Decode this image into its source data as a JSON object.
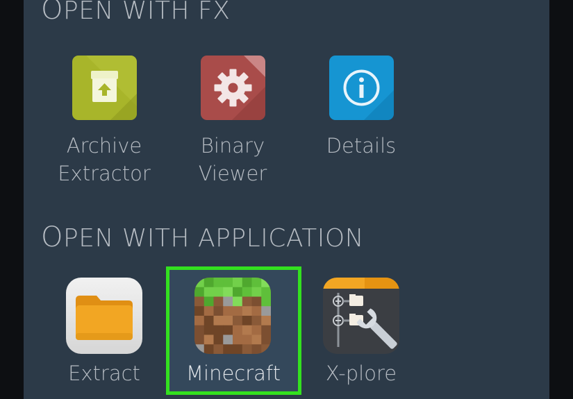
{
  "sections": {
    "fx": {
      "title_first": "O",
      "title_rest": "PEN WITH FX"
    },
    "app": {
      "title_first": "O",
      "title_rest": "PEN WITH APPLICATION"
    }
  },
  "fx_apps": [
    {
      "label": "Archive\nExtractor",
      "icon": "archive-extractor-icon",
      "color": "#a8b52a"
    },
    {
      "label": "Binary\nViewer",
      "icon": "binary-viewer-gear-icon",
      "color": "#a94c4a"
    },
    {
      "label": "Details",
      "icon": "details-info-icon",
      "color": "#1695d2"
    }
  ],
  "apps": [
    {
      "label": "Extract",
      "icon": "extract-folder-icon",
      "color": "#f0a522"
    },
    {
      "label": "Minecraft",
      "icon": "minecraft-grass-block-icon",
      "selected": true,
      "highlight_color": "#33e11f"
    },
    {
      "label": "X-plore",
      "icon": "x-plore-wrench-icon",
      "color": "#3a3d42"
    }
  ]
}
